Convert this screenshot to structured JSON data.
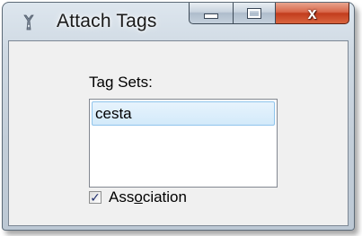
{
  "window": {
    "title": "Attach Tags",
    "icon": "tag-app-icon",
    "caption_buttons": {
      "minimize_icon": "minimize-icon",
      "maximize_icon": "maximize-icon",
      "close_label": "x",
      "close_color": "#c23c1d"
    }
  },
  "tag_sets": {
    "label": "Tag Sets:",
    "items": [
      {
        "label": "cesta",
        "selected": true
      }
    ],
    "selection_color": "#d3eafa"
  },
  "association": {
    "label_pre": "Ass",
    "label_access_key": "o",
    "label_post": "ciation",
    "checked": true
  }
}
